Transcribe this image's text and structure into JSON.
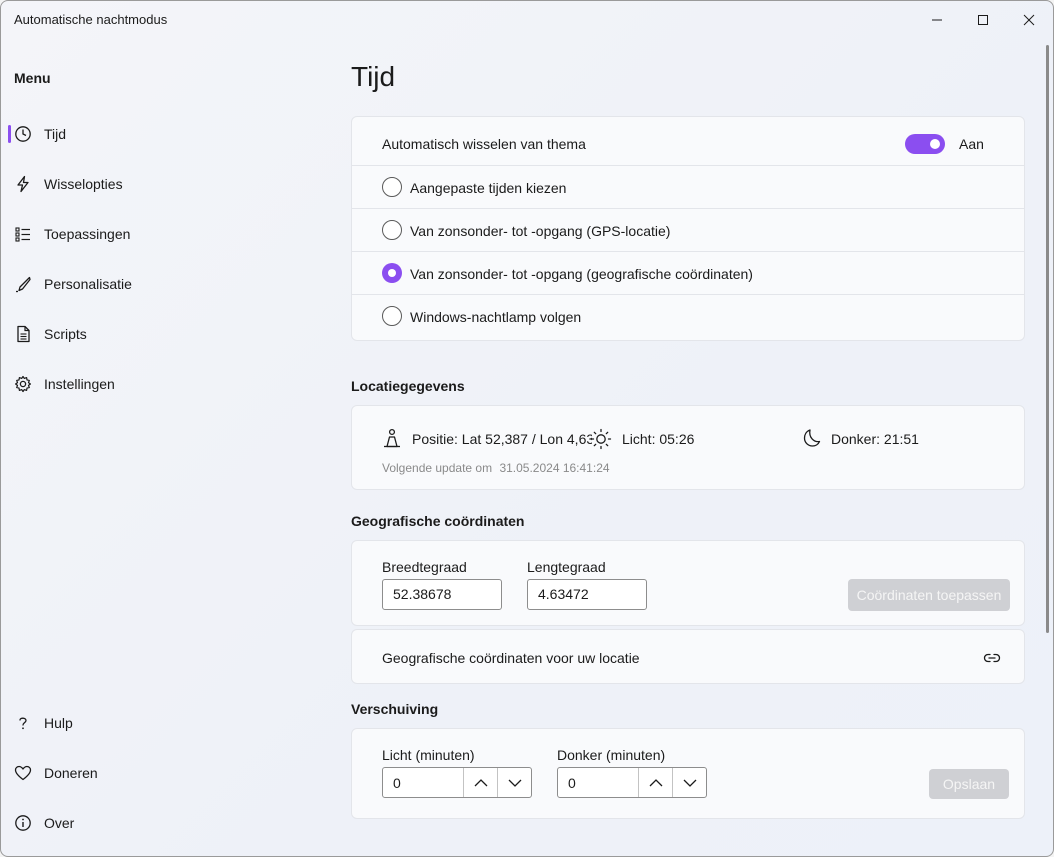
{
  "window": {
    "title": "Automatische nachtmodus"
  },
  "sidebar": {
    "menu_title": "Menu",
    "items": [
      {
        "label": "Tijd",
        "icon": "clock-icon"
      },
      {
        "label": "Wisselopties",
        "icon": "lightning-icon"
      },
      {
        "label": "Toepassingen",
        "icon": "list-icon"
      },
      {
        "label": "Personalisatie",
        "icon": "brush-icon"
      },
      {
        "label": "Scripts",
        "icon": "document-icon"
      },
      {
        "label": "Instellingen",
        "icon": "gear-icon"
      }
    ],
    "footer_items": [
      {
        "label": "Hulp",
        "icon": "question-icon"
      },
      {
        "label": "Doneren",
        "icon": "heart-icon"
      },
      {
        "label": "Over",
        "icon": "info-icon"
      }
    ]
  },
  "main": {
    "page_title": "Tijd",
    "theme_card": {
      "auto_switch_label": "Automatisch wisselen van thema",
      "toggle_state": "Aan",
      "options": [
        {
          "label": "Aangepaste tijden kiezen",
          "checked": false
        },
        {
          "label": "Van zonsonder- tot -opgang (GPS-locatie)",
          "checked": false
        },
        {
          "label": "Van zonsonder- tot -opgang (geografische coördinaten)",
          "checked": true
        },
        {
          "label": "Windows-nachtlamp volgen",
          "checked": false
        }
      ]
    },
    "location": {
      "section_title": "Locatiegegevens",
      "position": "Positie: Lat 52,387 / Lon 4,635",
      "light": "Licht: 05:26",
      "dark": "Donker: 21:51",
      "next_update_label": "Volgende update om",
      "next_update_value": "31.05.2024 16:41:24"
    },
    "coordinates": {
      "section_title": "Geografische coördinaten",
      "lat_label": "Breedtegraad",
      "lat_value": "52.38678",
      "lon_label": "Lengtegraad",
      "lon_value": "4.63472",
      "apply_button": "Coördinaten toepassen",
      "link_label": "Geografische coördinaten voor uw locatie"
    },
    "offset": {
      "section_title": "Verschuiving",
      "light_label": "Licht (minuten)",
      "light_value": "0",
      "dark_label": "Donker (minuten)",
      "dark_value": "0",
      "save_button": "Opslaan"
    }
  },
  "colors": {
    "accent": "#8b4ef0"
  }
}
